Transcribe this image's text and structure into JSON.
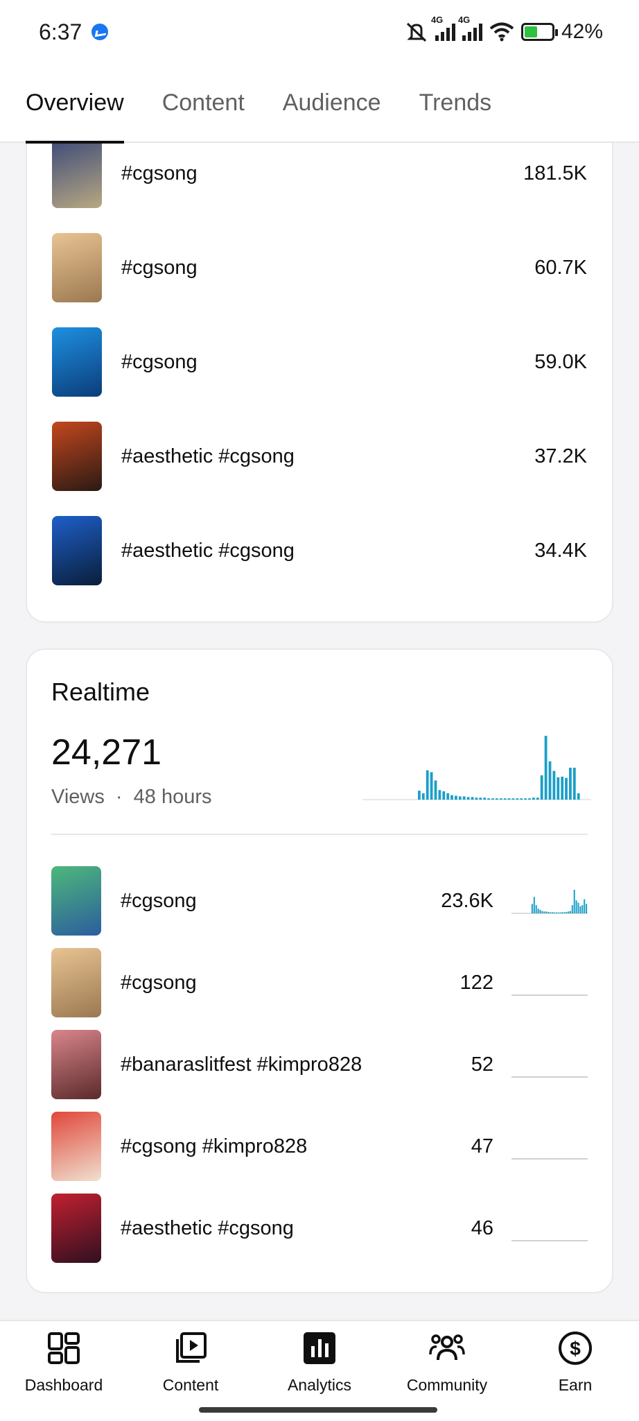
{
  "status_bar": {
    "time": "6:37",
    "battery": "42%"
  },
  "tabs": [
    {
      "label": "Overview",
      "active": true
    },
    {
      "label": "Content",
      "active": false
    },
    {
      "label": "Audience",
      "active": false
    },
    {
      "label": "Trends",
      "active": false
    }
  ],
  "top_content": [
    {
      "title": "#cgsong",
      "value": "181.5K",
      "thumb_colors": [
        "#3b4a78",
        "#b8a882"
      ]
    },
    {
      "title": "#cgsong",
      "value": "60.7K",
      "thumb_colors": [
        "#e8c493",
        "#9b7850"
      ]
    },
    {
      "title": "#cgsong",
      "value": "59.0K",
      "thumb_colors": [
        "#1e90e0",
        "#0b3d7a"
      ]
    },
    {
      "title": "#aesthetic #cgsong",
      "value": "37.2K",
      "thumb_colors": [
        "#c4471e",
        "#2a1a14"
      ]
    },
    {
      "title": "#aesthetic #cgsong",
      "value": "34.4K",
      "thumb_colors": [
        "#1e5fc9",
        "#0a1e3a"
      ]
    }
  ],
  "realtime": {
    "title": "Realtime",
    "views": "24,271",
    "views_label": "Views",
    "separator": "·",
    "period": "48 hours",
    "chart_color": "#1a9fc9",
    "rows": [
      {
        "title": "#cgsong",
        "value": "23.6K",
        "thumb_colors": [
          "#4db87a",
          "#2c5d9e"
        ]
      },
      {
        "title": "#cgsong",
        "value": "122",
        "thumb_colors": [
          "#e8c493",
          "#9b7850"
        ]
      },
      {
        "title": "#banaraslitfest #kimpro828",
        "value": "52",
        "thumb_colors": [
          "#d9868c",
          "#5a2a2a"
        ]
      },
      {
        "title": "#cgsong #kimpro828",
        "value": "47",
        "thumb_colors": [
          "#e0473a",
          "#f0e0d0"
        ]
      },
      {
        "title": "#aesthetic #cgsong",
        "value": "46",
        "thumb_colors": [
          "#c22030",
          "#301020"
        ]
      }
    ]
  },
  "bottom_nav": [
    {
      "label": "Dashboard",
      "icon": "dashboard-icon"
    },
    {
      "label": "Content",
      "icon": "content-icon"
    },
    {
      "label": "Analytics",
      "icon": "analytics-icon",
      "active": true
    },
    {
      "label": "Community",
      "icon": "community-icon"
    },
    {
      "label": "Earn",
      "icon": "earn-icon"
    }
  ]
}
